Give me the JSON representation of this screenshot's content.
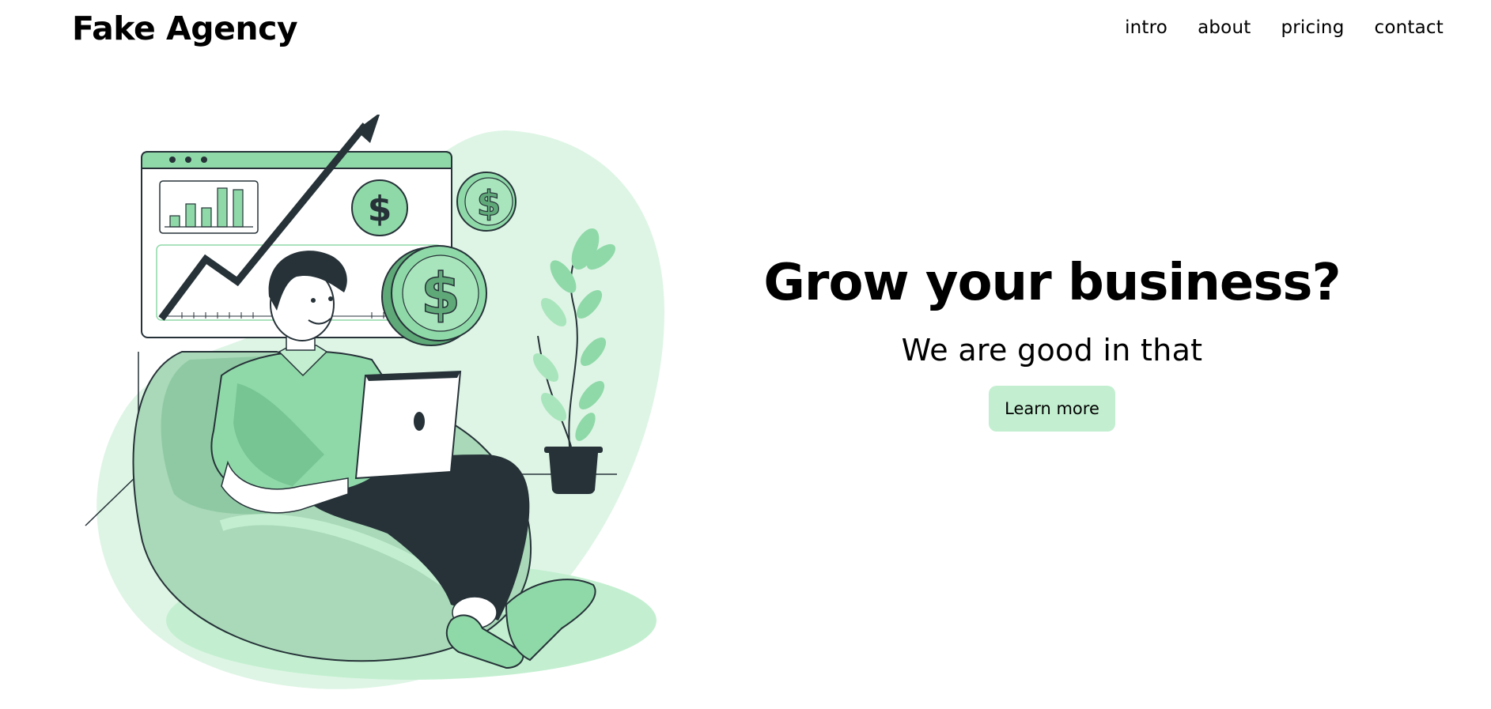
{
  "header": {
    "logo": "Fake Agency",
    "nav": [
      {
        "label": "intro"
      },
      {
        "label": "about"
      },
      {
        "label": "pricing"
      },
      {
        "label": "contact"
      }
    ]
  },
  "hero": {
    "title": "Grow your business?",
    "subtitle": "We are good in that",
    "cta_label": "Learn more"
  },
  "colors": {
    "accent_light": "#c3efd0",
    "accent": "#8fd9a8",
    "accent_dark": "#5fa878",
    "ink": "#263238"
  }
}
